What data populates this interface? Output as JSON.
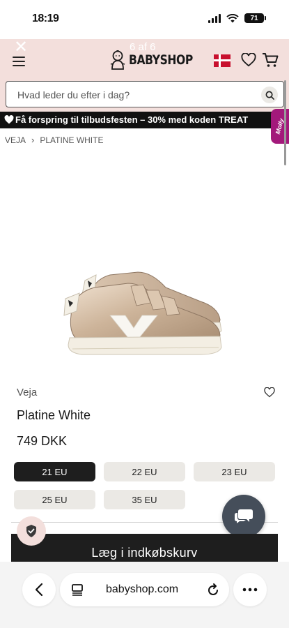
{
  "status_bar": {
    "time": "18:19",
    "battery": "71"
  },
  "header": {
    "counter": "6 af 6",
    "logo_text": "BABYSHOP"
  },
  "search": {
    "placeholder": "Hvad leder du efter i dag?"
  },
  "promo": {
    "text": "Få forspring til tilbudsfesten – 30% med koden TREAT"
  },
  "side_tab": {
    "label": "Molly"
  },
  "breadcrumb": [
    {
      "label": "VEJA"
    },
    {
      "label": "PLATINE WHITE"
    }
  ],
  "product": {
    "brand": "Veja",
    "title": "Platine White",
    "price": "749 DKK",
    "image_alt": "Gold metallic velcro sneaker with white V logo",
    "sizes": [
      {
        "label": "21 EU",
        "selected": true
      },
      {
        "label": "22 EU",
        "selected": false
      },
      {
        "label": "23 EU",
        "selected": false
      },
      {
        "label": "25 EU",
        "selected": false
      },
      {
        "label": "35 EU",
        "selected": false
      }
    ],
    "add_to_cart": "Læg i indkøbskurv"
  },
  "browser": {
    "url": "babyshop.com"
  },
  "colors": {
    "header_bg": "#f3dfdc",
    "promo_bg": "#111111",
    "selected_size": "#1e1e1e",
    "size_bg": "#ebe9e5",
    "side_tab": "#a3197b",
    "chat_button": "#454e5a"
  }
}
